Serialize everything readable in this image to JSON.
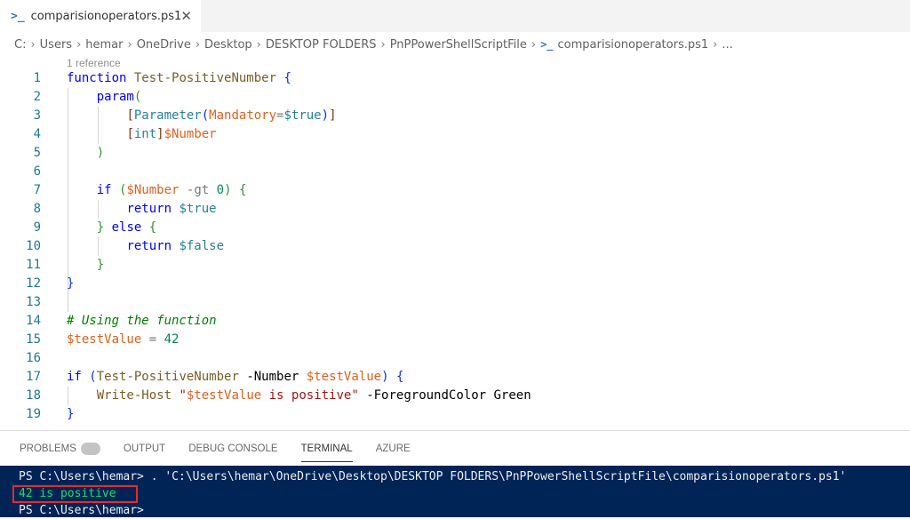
{
  "tab": {
    "title": "comparisionoperators.ps1",
    "close": "✕"
  },
  "breadcrumb": [
    "C:",
    "Users",
    "hemar",
    "OneDrive",
    "Desktop",
    "DESKTOP FOLDERS",
    "PnPPowerShellScriptFile",
    "comparisionoperators.ps1",
    "..."
  ],
  "editor": {
    "codelens": "1 reference",
    "line_numbers": [
      "1",
      "2",
      "3",
      "4",
      "5",
      "6",
      "7",
      "8",
      "9",
      "10",
      "11",
      "12",
      "13",
      "14",
      "15",
      "16",
      "17",
      "18",
      "19"
    ]
  },
  "panel": {
    "tabs": [
      "PROBLEMS",
      "OUTPUT",
      "DEBUG CONSOLE",
      "TERMINAL",
      "AZURE"
    ],
    "active_tab": "TERMINAL"
  },
  "terminal": {
    "line1": "PS C:\\Users\\hemar> . 'C:\\Users\\hemar\\OneDrive\\Desktop\\DESKTOP FOLDERS\\PnPPowerShellScriptFile\\comparisionoperators.ps1'",
    "line2": "42 is positive",
    "line3": "PS C:\\Users\\hemar>"
  },
  "colors": {
    "terminal_bg": "#012456",
    "output_green": "#13e26a",
    "highlight": "#e32c2c"
  }
}
